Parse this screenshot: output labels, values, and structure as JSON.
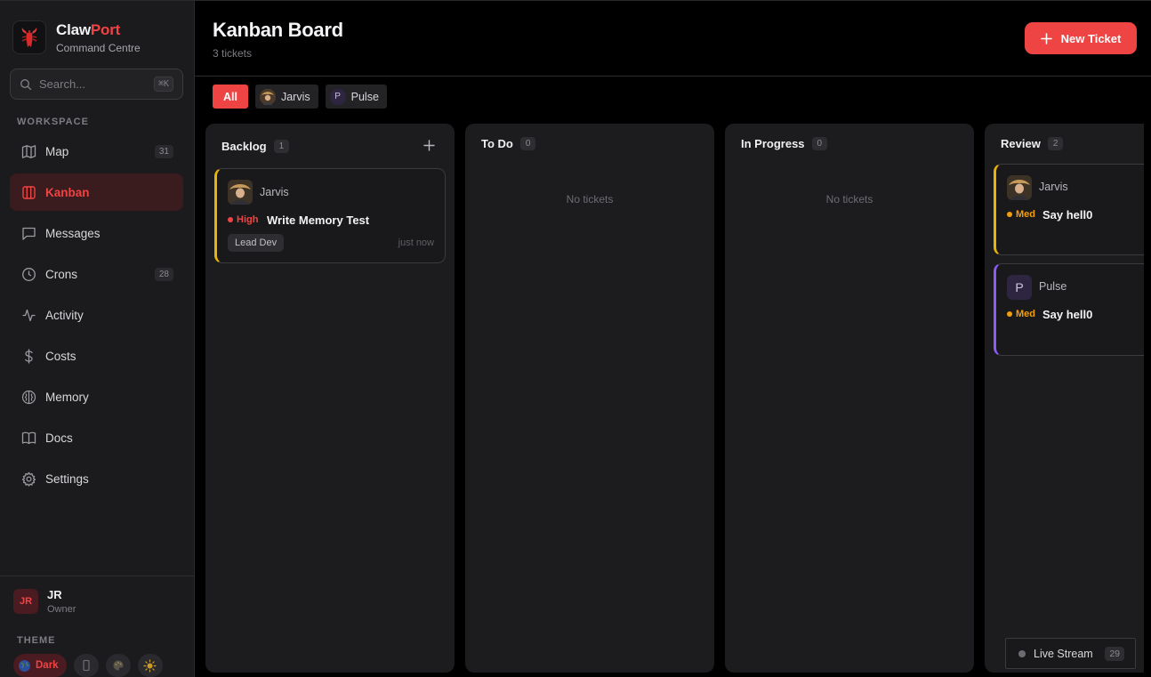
{
  "brand": {
    "name_part1": "Claw",
    "name_part2": "Port",
    "subtitle": "Command Centre",
    "accent_color": "#ef4444"
  },
  "search": {
    "placeholder": "Search...",
    "shortcut": "⌘K"
  },
  "sidebar": {
    "section_label": "WORKSPACE",
    "items": [
      {
        "label": "Map",
        "icon": "map-icon",
        "count": "31"
      },
      {
        "label": "Kanban",
        "icon": "kanban-icon",
        "active": true
      },
      {
        "label": "Messages",
        "icon": "message-icon"
      },
      {
        "label": "Crons",
        "icon": "clock-icon",
        "count": "28"
      },
      {
        "label": "Activity",
        "icon": "activity-icon"
      },
      {
        "label": "Costs",
        "icon": "dollar-icon"
      },
      {
        "label": "Memory",
        "icon": "brain-icon"
      },
      {
        "label": "Docs",
        "icon": "book-icon"
      },
      {
        "label": "Settings",
        "icon": "gear-icon"
      }
    ]
  },
  "user": {
    "initials": "JR",
    "name": "JR",
    "role": "Owner"
  },
  "theme": {
    "label": "THEME",
    "active": "Dark",
    "options": [
      "dark-globe-icon",
      "phone-icon",
      "palette-icon",
      "sun-icon"
    ]
  },
  "header": {
    "title": "Kanban Board",
    "subtitle": "3 tickets",
    "new_button": "New Ticket"
  },
  "filters": {
    "all": "All",
    "agents": [
      "Jarvis",
      "Pulse"
    ],
    "pulse_initial": "P"
  },
  "columns": [
    {
      "title": "Backlog",
      "count": "1"
    },
    {
      "title": "To Do",
      "count": "0",
      "empty": "No tickets"
    },
    {
      "title": "In Progress",
      "count": "0",
      "empty": "No tickets"
    },
    {
      "title": "Review",
      "count": "2"
    }
  ],
  "tickets": [
    {
      "agent": "Jarvis",
      "priority": "High",
      "priority_color": "#ef4444",
      "title": "Write Memory Test",
      "tag": "Lead Dev",
      "time": "just now"
    },
    {
      "agent": "Jarvis",
      "priority": "Med",
      "priority_color": "#f59e0b",
      "title": "Say hell0"
    },
    {
      "agent": "Pulse",
      "agent_initial": "P",
      "priority": "Med",
      "priority_color": "#f59e0b",
      "title": "Say hell0"
    }
  ],
  "live_stream": {
    "label": "Live Stream",
    "count": "29"
  }
}
